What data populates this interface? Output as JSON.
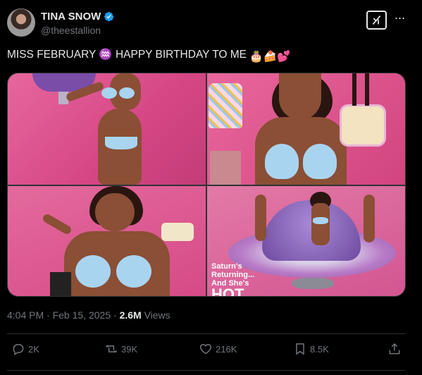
{
  "author": {
    "display_name": "TINA SNOW",
    "handle": "@theestallion",
    "avatar_icon": "profile-avatar",
    "verified_color": "#1d9bf0"
  },
  "tweet": {
    "text": "MISS FEBRUARY ♒ HAPPY BIRTHDAY TO ME",
    "emojis": [
      "🎂",
      "🍰",
      "💕"
    ]
  },
  "media": {
    "cover_lines": [
      "Saturn's",
      "Returning...",
      "And She's"
    ],
    "cover_big": "HOT"
  },
  "meta": {
    "time": "4:04 PM",
    "date": "Feb 15, 2025",
    "views_count": "2.6M",
    "views_label": "Views"
  },
  "actions": {
    "reply_count": "2K",
    "repost_count": "39K",
    "like_count": "216K",
    "bookmark_count": "8.5K"
  },
  "colors": {
    "background": "#000000",
    "text": "#e7e9ea",
    "muted": "#71767b",
    "divider": "#2f3336"
  }
}
